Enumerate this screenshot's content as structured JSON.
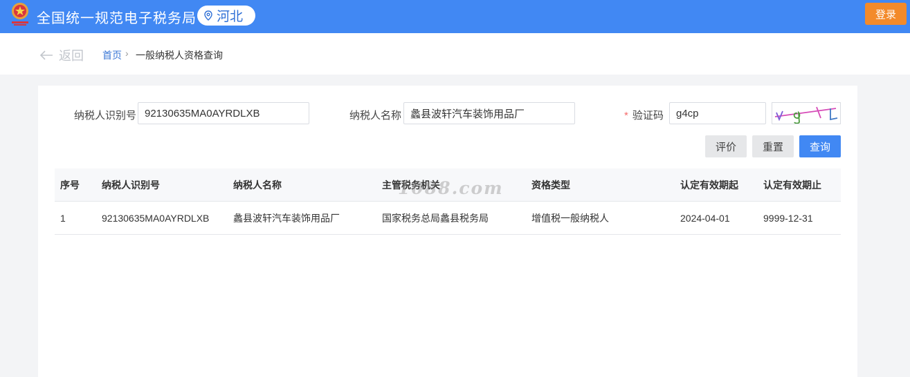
{
  "header": {
    "title": "全国统一规范电子税务局",
    "region": "河北",
    "login_label": "登录",
    "brand_color": "#4188f3",
    "login_color": "#f38a2a"
  },
  "breadcrumb": {
    "back_label": "返回",
    "home": "首页",
    "separator": "›",
    "current": "一般纳税人资格查询"
  },
  "form": {
    "taxpayer_id": {
      "label": "纳税人识别号",
      "value": "92130635MA0AYRDLXB"
    },
    "taxpayer_name": {
      "label": "纳税人名称",
      "value": "蠡县波轩汽车装饰用品厂"
    },
    "captcha": {
      "required_mark": "*",
      "label": "验证码",
      "value": "g4cp",
      "image_icon": "captcha-image"
    },
    "buttons": {
      "evaluate": "评价",
      "reset": "重置",
      "query": "查询"
    }
  },
  "table": {
    "columns": [
      "序号",
      "纳税人识别号",
      "纳税人名称",
      "主管税务机关",
      "资格类型",
      "认定有效期起",
      "认定有效期止"
    ],
    "rows": [
      [
        "1",
        "92130635MA0AYRDLXB",
        "蠡县波轩汽车装饰用品厂",
        "国家税务总局蠡县税务局",
        "增值税一般纳税人",
        "2024-04-01",
        "9999-12-31"
      ]
    ]
  },
  "watermark": "1088.com"
}
